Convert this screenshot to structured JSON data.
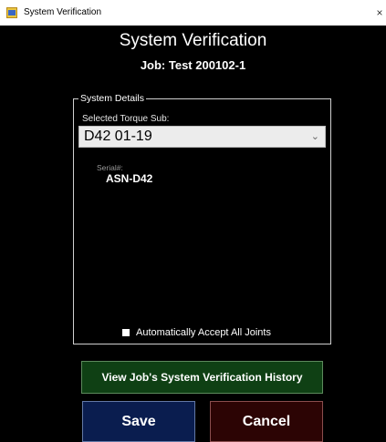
{
  "window": {
    "title": "System Verification",
    "close_glyph": "×",
    "icon": "app-window-icon"
  },
  "header": {
    "title": "System Verification",
    "job": "Job: Test 200102-1"
  },
  "details": {
    "legend": "System Details",
    "torque_label": "Selected Torque Sub:",
    "torque_value": "D42 01-19",
    "serial_label": "Serial#:",
    "serial_value": "ASN-D42",
    "auto_accept_label": "Automatically Accept All Joints"
  },
  "buttons": {
    "history": "View Job's System Verification History",
    "save": "Save",
    "cancel": "Cancel"
  },
  "colors": {
    "background": "#000000",
    "history_button": "#0f4014",
    "save_button": "#0a1d4f",
    "cancel_button": "#2c0404"
  }
}
